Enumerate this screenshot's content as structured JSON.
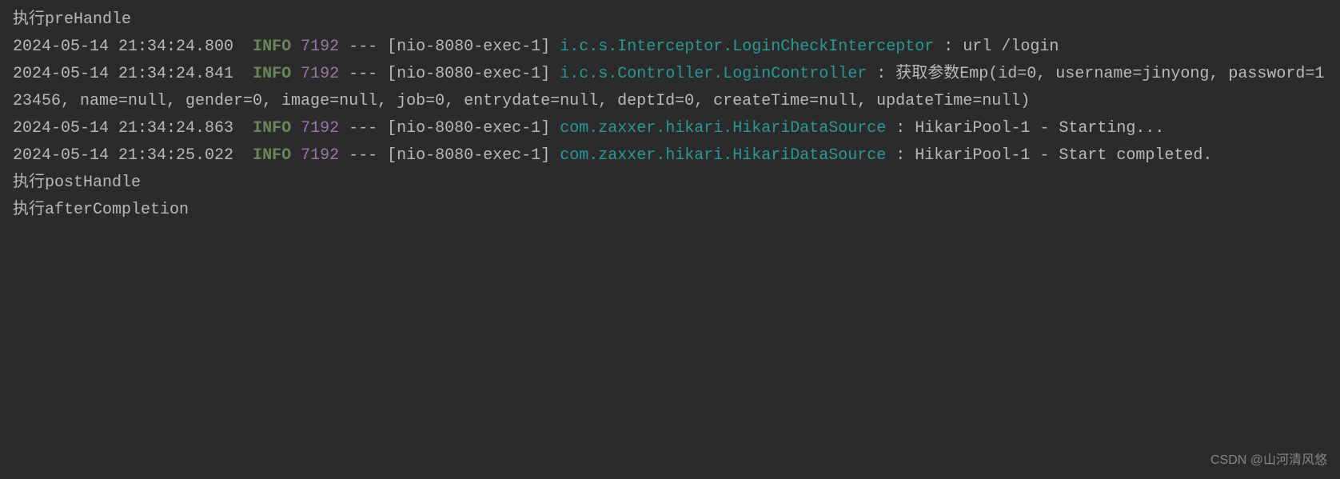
{
  "lines": {
    "line0": "执行preHandle",
    "line1_timestamp": "2024-05-14 21:34:24.800",
    "line1_level": "INFO",
    "line1_pid": "7192",
    "line1_dashes": "---",
    "line1_thread": "[nio-8080-exec-1]",
    "line1_logger": "i.c.s.Interceptor.LoginCheckInterceptor",
    "line1_message": " : url /login",
    "line2_timestamp": "2024-05-14 21:34:24.841",
    "line2_level": "INFO",
    "line2_pid": "7192",
    "line2_dashes": "---",
    "line2_thread": "[nio-8080-exec-1]",
    "line2_logger": "i.c.s.Controller.LoginController",
    "line2_message": " : 获取参数Emp(id=0, username=jinyong, password=123456, name=null, gender=0, image=null, job=0, entrydate=null, deptId=0, createTime=null, updateTime=null)",
    "line3_timestamp": "2024-05-14 21:34:24.863",
    "line3_level": "INFO",
    "line3_pid": "7192",
    "line3_dashes": "---",
    "line3_thread": "[nio-8080-exec-1]",
    "line3_logger": "com.zaxxer.hikari.HikariDataSource",
    "line3_message": " : HikariPool-1 - Starting...",
    "line4_timestamp": "2024-05-14 21:34:25.022",
    "line4_level": "INFO",
    "line4_pid": "7192",
    "line4_dashes": "---",
    "line4_thread": "[nio-8080-exec-1]",
    "line4_logger": "com.zaxxer.hikari.HikariDataSource",
    "line4_message": " : HikariPool-1 - Start completed.",
    "line5": "执行postHandle",
    "line6": "执行afterCompletion"
  },
  "watermark": "CSDN @山河清风悠",
  "sp": "  ",
  "sp1": " "
}
